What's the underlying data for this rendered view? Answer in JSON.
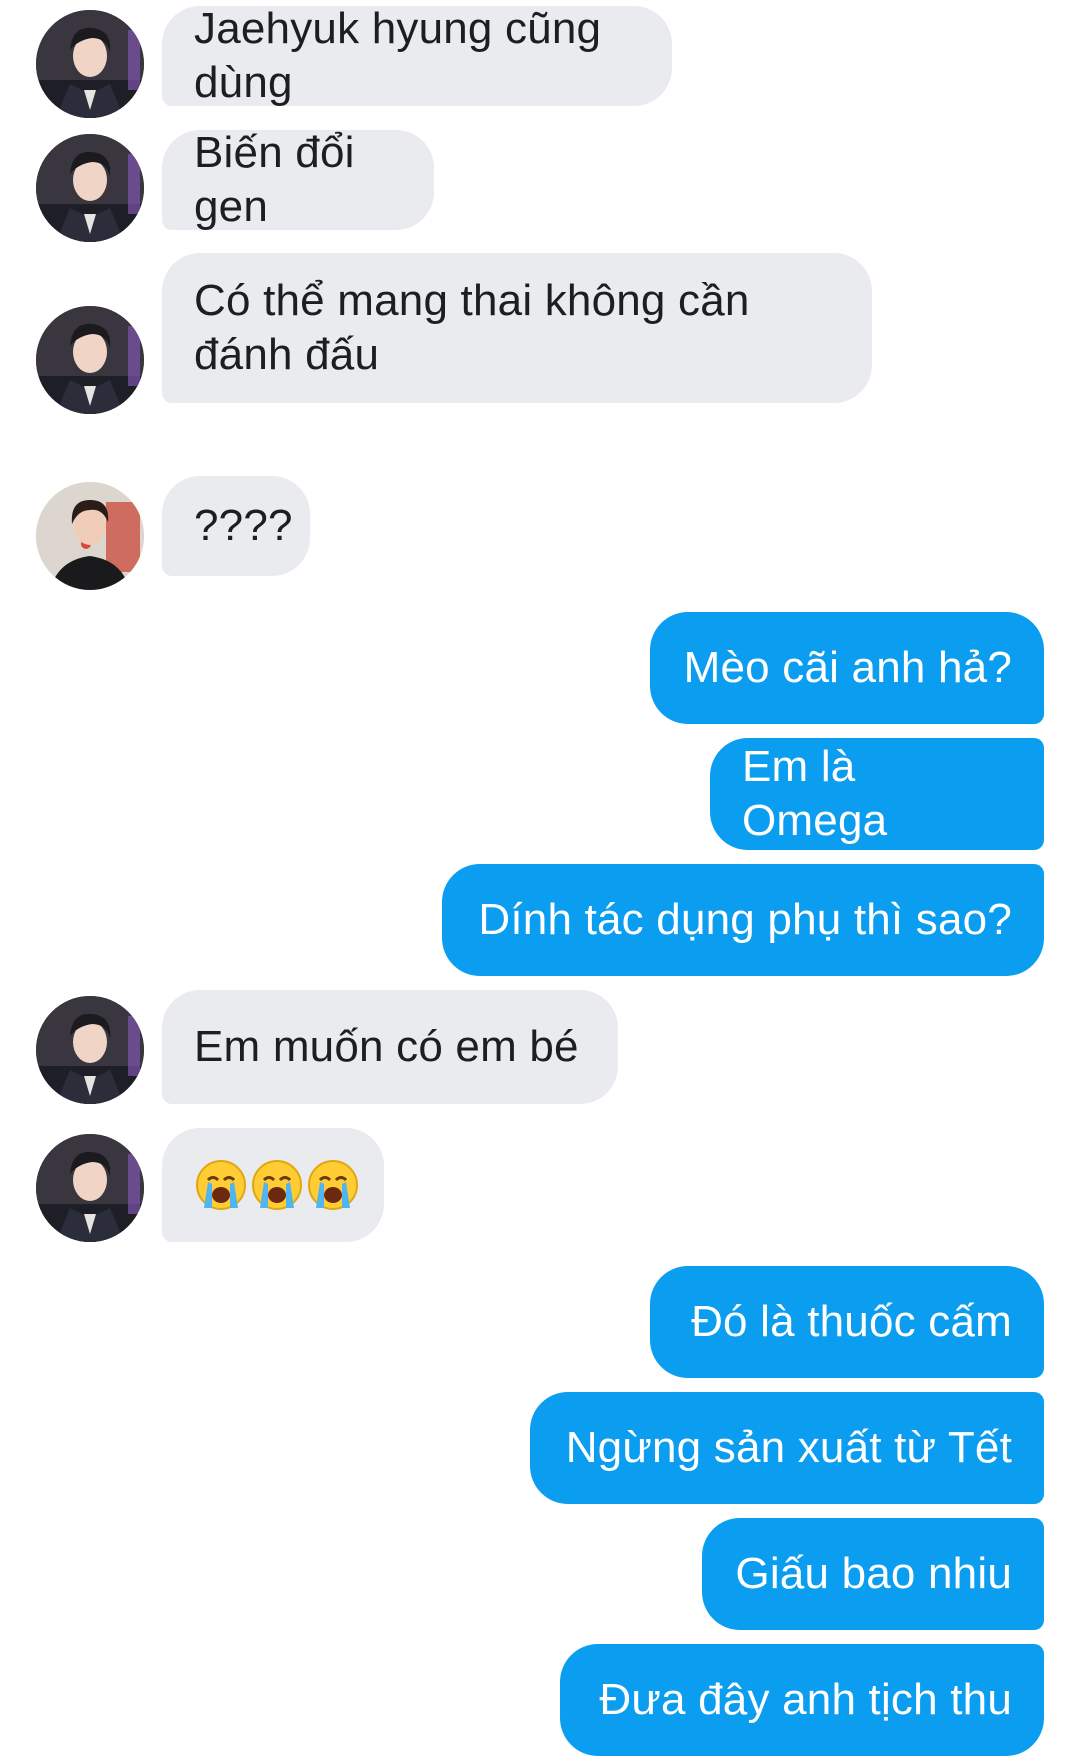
{
  "conversation": {
    "messages": [
      {
        "side": "incoming",
        "avatar": "avatar-a",
        "text": "Jaehyuk hyung cũng dùng"
      },
      {
        "side": "incoming",
        "avatar": "avatar-a",
        "text": "Biến đổi gen"
      },
      {
        "side": "incoming",
        "avatar": "avatar-a",
        "text": "Có thể mang thai không cần\nđánh đấu"
      },
      {
        "side": "incoming",
        "avatar": "avatar-b",
        "text": "????"
      },
      {
        "side": "outgoing",
        "text": "Mèo cãi anh hả?"
      },
      {
        "side": "outgoing",
        "text": "Em là Omega"
      },
      {
        "side": "outgoing",
        "text": "Dính tác dụng phụ thì sao?"
      },
      {
        "side": "incoming",
        "avatar": "avatar-a",
        "text": "Em muốn có em bé"
      },
      {
        "side": "incoming",
        "avatar": "avatar-a",
        "emoji": [
          "crying-face-icon",
          "crying-face-icon",
          "crying-face-icon"
        ]
      },
      {
        "side": "outgoing",
        "text": "Đó là thuốc cấm"
      },
      {
        "side": "outgoing",
        "text": "Ngừng sản xuất từ Tết"
      },
      {
        "side": "outgoing",
        "text": "Giấu bao nhiu"
      },
      {
        "side": "outgoing",
        "text": "Đưa đây anh tịch thu"
      }
    ]
  },
  "colors": {
    "incoming_bubble": "#e9ebee",
    "incoming_text": "#1c1e21",
    "outgoing_bubble": "#0b9df0",
    "outgoing_text": "#ffffff"
  }
}
